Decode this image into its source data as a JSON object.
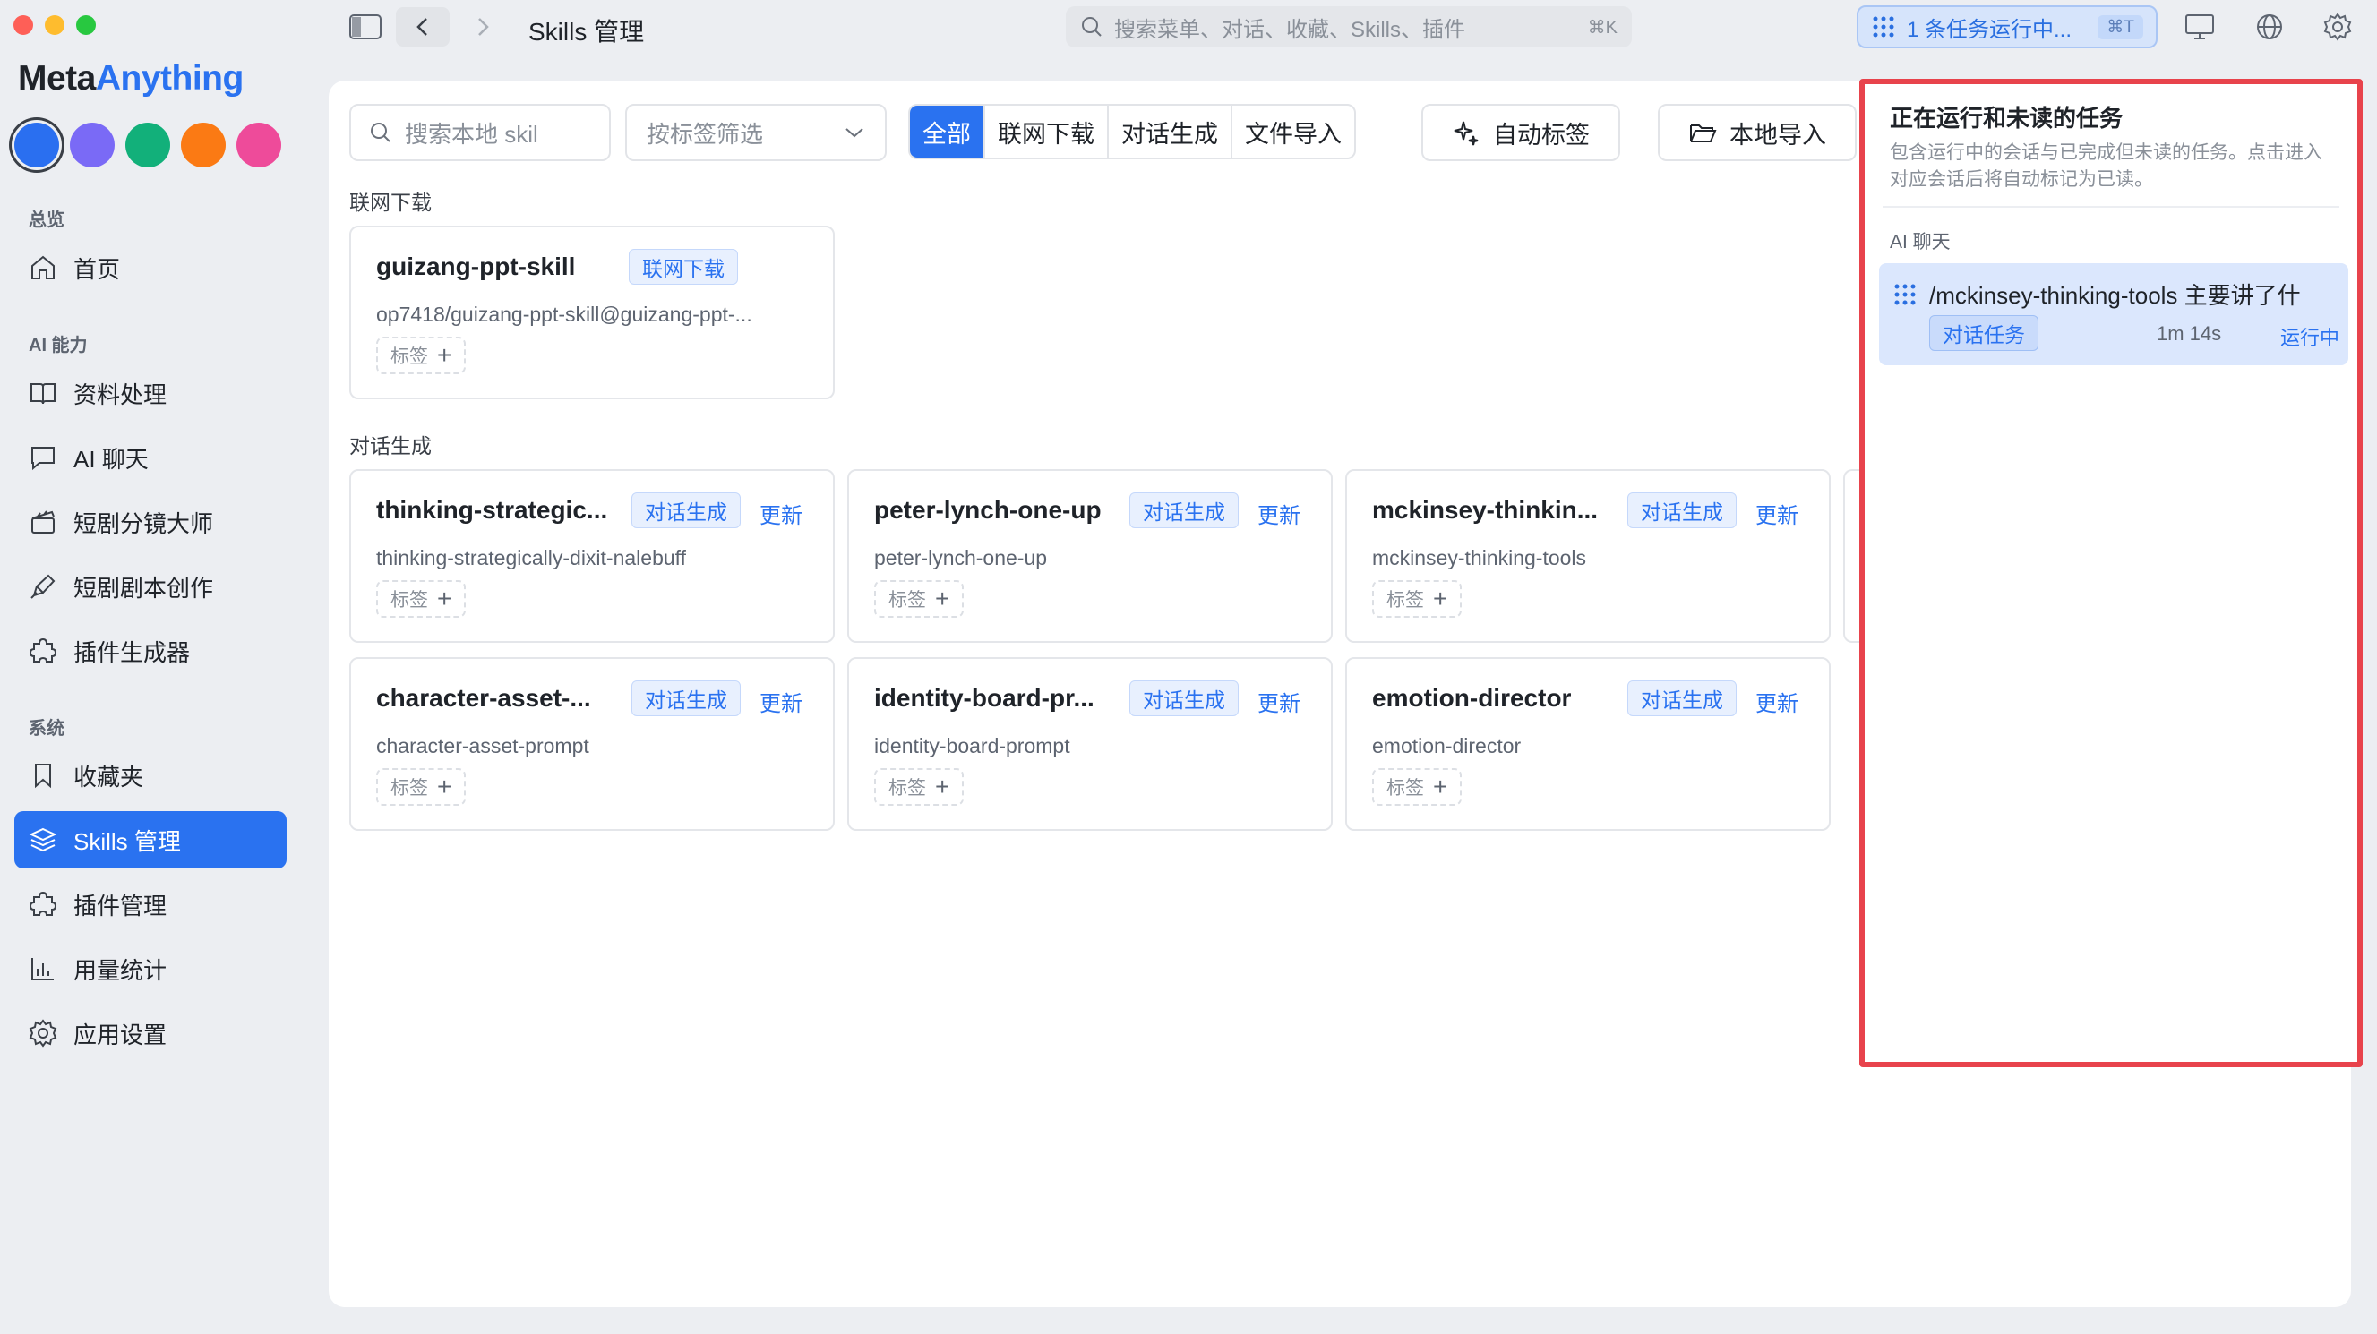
{
  "window": {
    "page_title": "Skills 管理",
    "search_placeholder": "搜索菜单、对话、收藏、Skills、插件",
    "search_shortcut": "⌘K",
    "task_pill_label": "1 条任务运行中...",
    "task_pill_shortcut": "⌘T"
  },
  "sidebar": {
    "logo_part1": "Meta",
    "logo_part2": "Anything",
    "theme_colors": [
      "#2a6ff0",
      "#7a6af6",
      "#12b07a",
      "#fb7a14",
      "#ee4b9a"
    ],
    "sections": [
      {
        "label": "总览",
        "items": [
          {
            "label": "首页",
            "icon": "home-icon"
          }
        ]
      },
      {
        "label": "AI 能力",
        "items": [
          {
            "label": "资料处理",
            "icon": "book-icon"
          },
          {
            "label": "AI 聊天",
            "icon": "chat-icon"
          },
          {
            "label": "短剧分镜大师",
            "icon": "clapper-icon"
          },
          {
            "label": "短剧剧本创作",
            "icon": "pen-icon"
          },
          {
            "label": "插件生成器",
            "icon": "puzzle-icon"
          }
        ]
      },
      {
        "label": "系统",
        "items": [
          {
            "label": "收藏夹",
            "icon": "bookmark-icon"
          },
          {
            "label": "Skills 管理",
            "icon": "layers-icon",
            "active": true
          },
          {
            "label": "插件管理",
            "icon": "puzzle-icon"
          },
          {
            "label": "用量统计",
            "icon": "bar-chart-icon"
          },
          {
            "label": "应用设置",
            "icon": "gear-icon"
          }
        ]
      }
    ]
  },
  "toolbar": {
    "search_placeholder": "搜索本地 skil",
    "tag_filter_placeholder": "按标签筛选",
    "filters": [
      "全部",
      "联网下载",
      "对话生成",
      "文件导入"
    ],
    "auto_tag_label": "自动标签",
    "local_import_label": "本地导入"
  },
  "groups": [
    {
      "label": "联网下载",
      "cards": [
        {
          "name": "guizang-ppt-skill",
          "source": "联网下载",
          "update": "",
          "subtitle": "op7418/guizang-ppt-skill@guizang-ppt-...",
          "tag_label": "标签"
        }
      ]
    },
    {
      "label": "对话生成",
      "cards": [
        {
          "name": "thinking-strategic...",
          "source": "对话生成",
          "update": "更新",
          "subtitle": "thinking-strategically-dixit-nalebuff",
          "tag_label": "标签"
        },
        {
          "name": "peter-lynch-one-up",
          "source": "对话生成",
          "update": "更新",
          "subtitle": "peter-lynch-one-up",
          "tag_label": "标签"
        },
        {
          "name": "mckinsey-thinkin...",
          "source": "对话生成",
          "update": "更新",
          "subtitle": "mckinsey-thinking-tools",
          "tag_label": "标签"
        },
        {
          "name": "character-asset-...",
          "source": "对话生成",
          "update": "更新",
          "subtitle": "character-asset-prompt",
          "tag_label": "标签"
        },
        {
          "name": "identity-board-pr...",
          "source": "对话生成",
          "update": "更新",
          "subtitle": "identity-board-prompt",
          "tag_label": "标签"
        },
        {
          "name": "emotion-director",
          "source": "对话生成",
          "update": "更新",
          "subtitle": "emotion-director",
          "tag_label": "标签"
        }
      ]
    }
  ],
  "popover": {
    "title": "正在运行和未读的任务",
    "description": "包含运行中的会话与已完成但未读的任务。点击进入对应会话后将自动标记为已读。",
    "section_label": "AI 聊天",
    "task": {
      "title": "/mckinsey-thinking-tools 主要讲了什",
      "badge": "对话任务",
      "duration": "1m 14s",
      "status": "运行中"
    }
  }
}
